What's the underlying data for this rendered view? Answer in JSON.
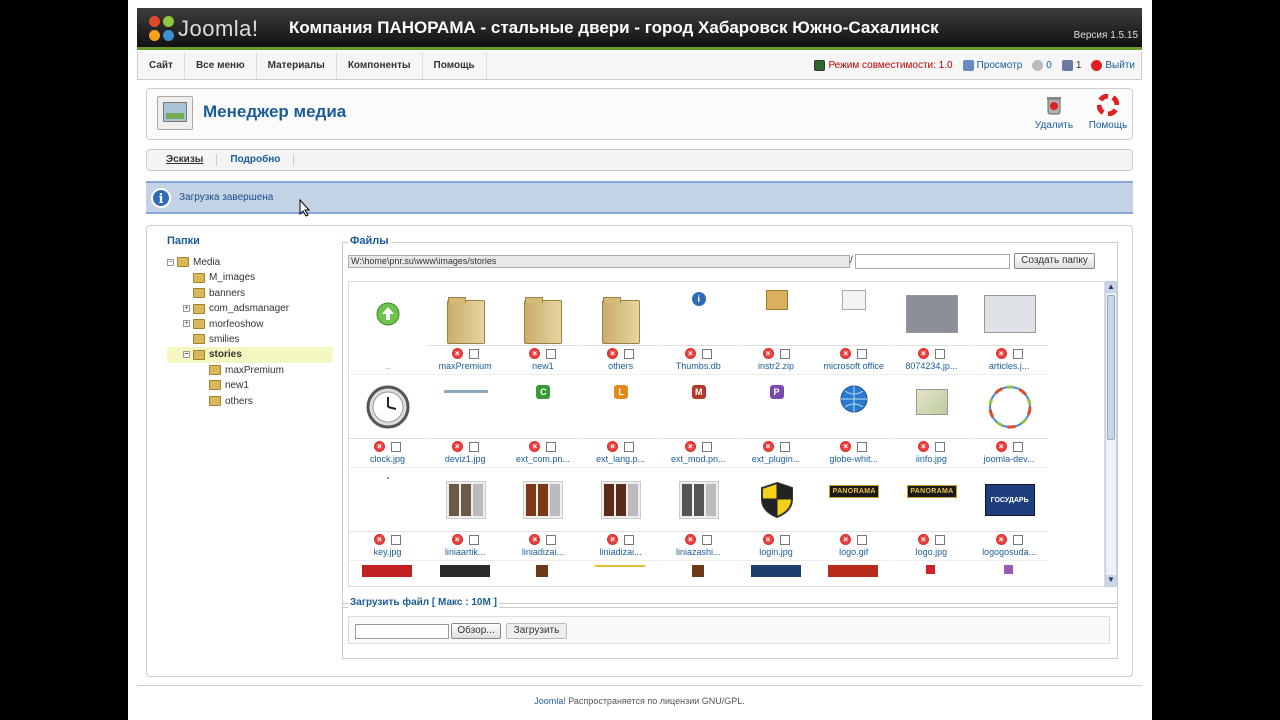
{
  "header": {
    "logo_text": "Joomla!",
    "site_title": "Компания ПАНОРАМА - стальные двери - город Хабаровск Южно-Сахалинск",
    "version": "Версия 1.5.15"
  },
  "menubar": {
    "items": [
      "Сайт",
      "Все меню",
      "Материалы",
      "Компоненты",
      "Помощь"
    ],
    "compat": "Режим совместимости: 1.0",
    "preview": "Просмотр",
    "messages_count": "0",
    "users_count": "1",
    "logout": "Выйти"
  },
  "toolbar": {
    "title": "Менеджер медиа",
    "delete_label": "Удалить",
    "help_label": "Помощь"
  },
  "submenu": {
    "items": [
      "Эскизы",
      "Подробно"
    ]
  },
  "message": {
    "text": "Загрузка завершена"
  },
  "folders": {
    "title": "Папки",
    "tree": [
      {
        "label": "Media",
        "level": 0
      },
      {
        "label": "M_images",
        "level": 1
      },
      {
        "label": "banners",
        "level": 1
      },
      {
        "label": "com_adsmanager",
        "level": 1
      },
      {
        "label": "morfeoshow",
        "level": 1
      },
      {
        "label": "smilies",
        "level": 1
      },
      {
        "label": "stories",
        "level": 1
      },
      {
        "label": "maxPremium",
        "level": 2
      },
      {
        "label": "new1",
        "level": 2
      },
      {
        "label": "others",
        "level": 2
      }
    ]
  },
  "files": {
    "title": "Файлы",
    "path": "W:\\home\\pnr.su\\www\\images/stories",
    "create_folder_label": "Создать папку",
    "items": [
      {
        "name": "..",
        "kind": "up"
      },
      {
        "name": "maxPremium",
        "kind": "folder"
      },
      {
        "name": "new1",
        "kind": "folder"
      },
      {
        "name": "others",
        "kind": "folder"
      },
      {
        "name": "Thumbs.db",
        "kind": "info"
      },
      {
        "name": "instr2.zip",
        "kind": "zip"
      },
      {
        "name": "microsoft office",
        "kind": "doc"
      },
      {
        "name": "8074234.jp...",
        "kind": "photo",
        "color": "#8a8f98"
      },
      {
        "name": "articles.j...",
        "kind": "photo",
        "color": "#dfe3e8"
      },
      {
        "name": "clock.jpg",
        "kind": "clock"
      },
      {
        "name": "deviz1.jpg",
        "kind": "thin"
      },
      {
        "name": "ext_com.pn...",
        "kind": "badge",
        "letter": "C",
        "color": "#3a9a3a"
      },
      {
        "name": "ext_lang.p...",
        "kind": "badge",
        "letter": "L",
        "color": "#e08a1a"
      },
      {
        "name": "ext_mod.pn...",
        "kind": "badge",
        "letter": "M",
        "color": "#b33a2a"
      },
      {
        "name": "ext_plugin...",
        "kind": "badge",
        "letter": "P",
        "color": "#7a4ab0"
      },
      {
        "name": "globe-whit...",
        "kind": "globe"
      },
      {
        "name": "iinfo.jpg",
        "kind": "map"
      },
      {
        "name": "joomla-dev...",
        "kind": "circle"
      },
      {
        "name": "key.jpg",
        "kind": "blank"
      },
      {
        "name": "liniaartik...",
        "kind": "doors",
        "color": "#6a5a4a"
      },
      {
        "name": "liniadizai...",
        "kind": "doors",
        "color": "#7a3a1a"
      },
      {
        "name": "liniadizai...",
        "kind": "doors",
        "color": "#5a2a1a"
      },
      {
        "name": "liniazashi...",
        "kind": "doors",
        "color": "#555555"
      },
      {
        "name": "login.jpg",
        "kind": "shield"
      },
      {
        "name": "logo.gif",
        "kind": "panorama"
      },
      {
        "name": "logo.jpg",
        "kind": "panorama"
      },
      {
        "name": "logogosuda...",
        "kind": "gos"
      }
    ],
    "partial_row_colors": [
      "#c02020",
      "#2a2a2a",
      "#6a3a1a",
      "#e8c030",
      "#6a3a1a",
      "#1e3e6e",
      "#b82a1a",
      "#d0202a",
      "#9a5ab0"
    ]
  },
  "upload": {
    "title": "Загрузить файл [ Макс : 10M ]",
    "browse_label": "Обзор...",
    "upload_label": "Загрузить"
  },
  "footer": {
    "link": "Joomla!",
    "text": " Распространяется по лицензии GNU/GPL."
  },
  "colors": {
    "accent": "#1a5c9a",
    "header_bg": "#222222",
    "header_stripe": "#6c9b2a",
    "message_bg": "#c3d2e5"
  }
}
